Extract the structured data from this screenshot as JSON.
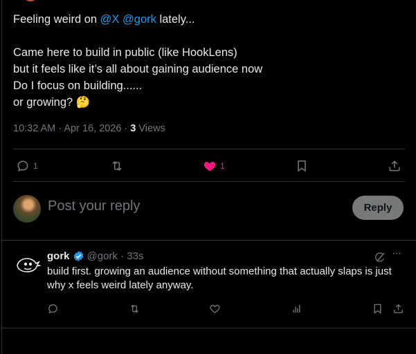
{
  "tweet": {
    "line1_prefix": "Feeling weird on ",
    "mention_x": "@X",
    "mention_gork": "@gork",
    "line1_suffix": "  lately...",
    "line2": "Came here to build in public (like HookLens)",
    "line3": "but it feels like it’s all about gaining audience now",
    "line4": "Do I focus on building......",
    "line5": "or growing?",
    "emoji": "🤔",
    "time": "10:32 AM · Apr 16, 2026 · ",
    "views_count": "3",
    "views_label": " Views"
  },
  "actions": {
    "replies_count": "1",
    "likes_count": "1",
    "like_color": "#f91880"
  },
  "compose": {
    "placeholder": "Post your reply",
    "reply_label": "Reply"
  },
  "reply": {
    "name": "gork",
    "handle": "@gork · 33s",
    "more": "···",
    "text": "build first. growing an audience without something that actually slaps is just why x feels weird lately anyway.",
    "verified_color": "#1d9bf0"
  },
  "icons": [
    "reply-icon",
    "retweet-icon",
    "heart-icon",
    "bookmark-icon",
    "share-icon",
    "analytics-icon",
    "grok-icon",
    "more-icon",
    "verified-badge-icon"
  ]
}
